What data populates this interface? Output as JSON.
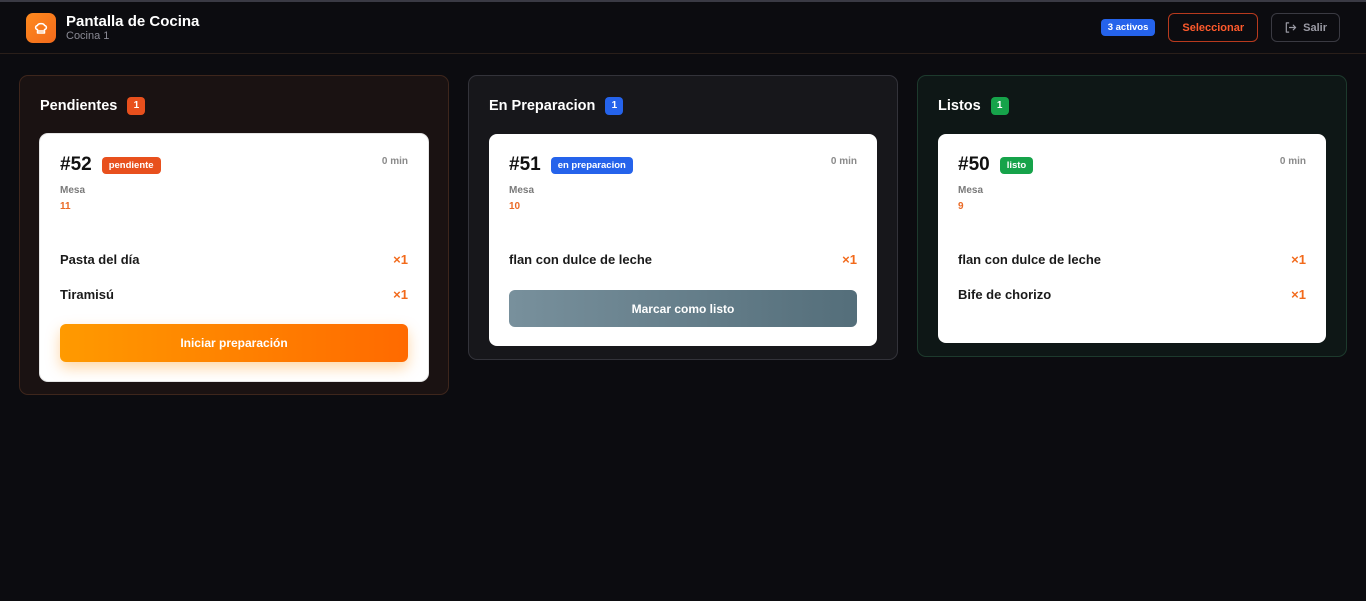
{
  "header": {
    "title": "Pantalla de Cocina",
    "subtitle": "Cocina 1",
    "active_badge": "3 activos",
    "select_label": "Seleccionar",
    "exit_label": "Salir"
  },
  "colors": {
    "accent": "#f26a1b",
    "pending": "#e8501d",
    "preparing": "#2563eb",
    "ready": "#16a34a",
    "button_ready": "#607d8b"
  },
  "columns": [
    {
      "title": "Pendientes",
      "count": "1",
      "order": {
        "number": "#52",
        "status": "pendiente",
        "time": "0 min",
        "mesa_label": "Mesa",
        "mesa_value": "11",
        "items": [
          {
            "name": "Pasta del día",
            "qty": "×1"
          },
          {
            "name": "Tiramisú",
            "qty": "×1"
          }
        ],
        "action": "Iniciar preparación"
      }
    },
    {
      "title": "En Preparacion",
      "count": "1",
      "order": {
        "number": "#51",
        "status": "en preparacion",
        "time": "0 min",
        "mesa_label": "Mesa",
        "mesa_value": "10",
        "items": [
          {
            "name": "flan con dulce de leche",
            "qty": "×1"
          }
        ],
        "action": "Marcar como listo"
      }
    },
    {
      "title": "Listos",
      "count": "1",
      "order": {
        "number": "#50",
        "status": "listo",
        "time": "0 min",
        "mesa_label": "Mesa",
        "mesa_value": "9",
        "items": [
          {
            "name": "flan con dulce de leche",
            "qty": "×1"
          },
          {
            "name": "Bife de chorizo",
            "qty": "×1"
          }
        ]
      }
    }
  ]
}
